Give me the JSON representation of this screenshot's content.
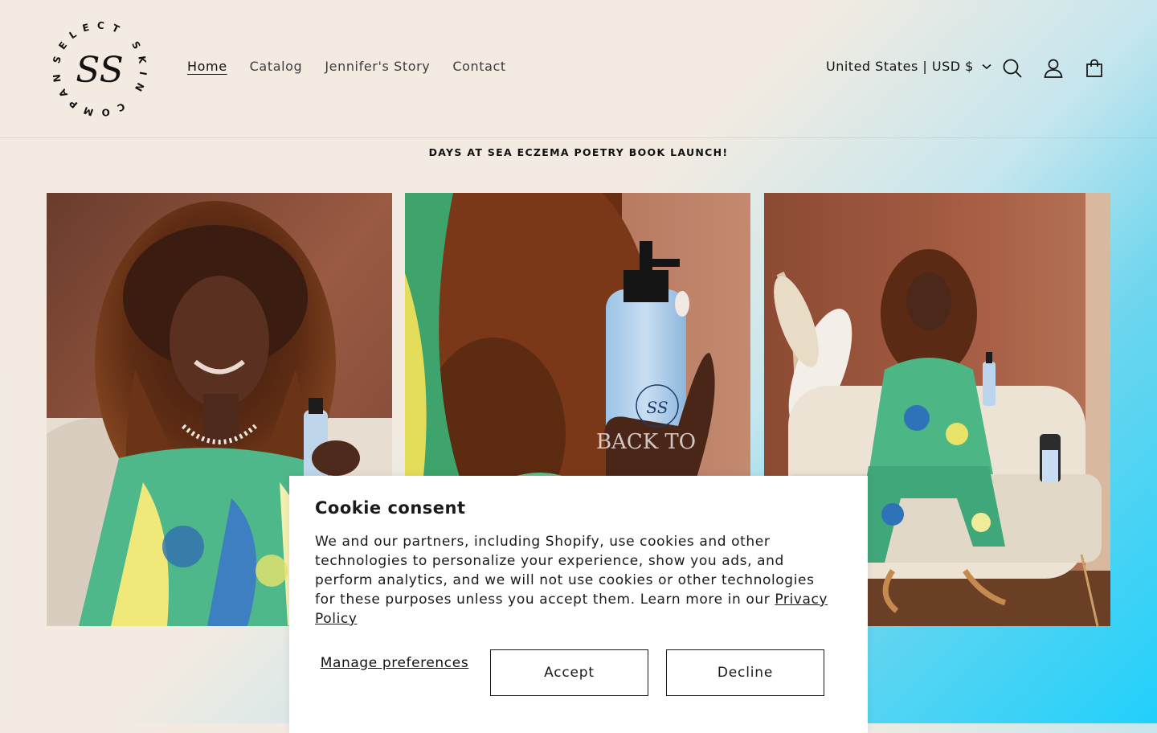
{
  "brand": {
    "monogram": "SS",
    "ring_text": "SELECT SKIN COMPANY"
  },
  "nav": {
    "items": [
      {
        "label": "Home",
        "active": true
      },
      {
        "label": "Catalog",
        "active": false
      },
      {
        "label": "Jennifer's Story",
        "active": false
      },
      {
        "label": "Contact",
        "active": false
      }
    ]
  },
  "header": {
    "country_label": "United States | USD $",
    "icons": [
      "search-icon",
      "account-icon",
      "cart-icon"
    ]
  },
  "announcement": "DAYS AT SEA ECZEMA POETRY BOOK LAUNCH!",
  "gallery": {
    "images": [
      "photo-woman-spraying-product",
      "photo-hand-holding-bottle",
      "photo-woman-on-sofa"
    ],
    "bottle_label_monogram": "SS",
    "bottle_label_text": "BACK TO"
  },
  "cookie": {
    "title": "Cookie consent",
    "body": "We and our partners, including Shopify, use cookies and other technologies to personalize your experience, show you ads, and perform analytics, and we will not use cookies or other technologies for these purposes unless you accept them. Learn more in our",
    "link": "Privacy Policy",
    "manage_label": "Manage preferences",
    "accept_label": "Accept",
    "decline_label": "Decline"
  },
  "colors": {
    "header_left": "#f3ebe1",
    "header_right": "#21d0fb",
    "text": "#121212"
  }
}
